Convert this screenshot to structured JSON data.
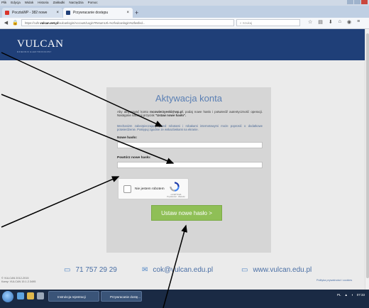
{
  "browser": {
    "menu": [
      "Plik",
      "Edycja",
      "Widok",
      "Historia",
      "Zakładki",
      "Narzędzia",
      "Pomoc"
    ],
    "tabs": [
      {
        "title": "PocztaWP - 382 nowe"
      },
      {
        "title": "Przywracanie dostępu"
      }
    ],
    "url_prefix": "https://cufs.",
    "url_domain": "vulcan.net.pl",
    "url_rest": "/vulcanlogin/Account/Login?ReturnUrl=%2fvulcanlogin%2fwsfed...",
    "search_placeholder": "Szukaj"
  },
  "header": {
    "logo": "VULCAN",
    "logo_sub": "DZIENNIK ELEKTRONICZNY"
  },
  "card": {
    "title": "Aktywacja konta",
    "intro_pre": "Aby aktywować konto ",
    "intro_email": "mcowierzyeski@wp.pl",
    "intro_post": ", podaj nowe hasło i potwierdź autentyczność operacji. Następnie naciśnij przycisk ",
    "intro_btn": "\"Ustaw nowe hasło\".",
    "note": "Mechanizm zabezpieczający przed robotami i robakami internetowymi może poprosić o dodatkowe potwierdzenie. Postępuj zgodnie ze wskazówkami na ekranie.",
    "new_password_label": "Nowe hasło:",
    "repeat_password_label": "Powtórz nowe hasło:",
    "captcha_label": "Nie jestem robotem",
    "captcha_brand": "reCAPTCHA",
    "captcha_terms": "Prywatność - Warunki",
    "submit_label": "Ustaw nowe hasło >"
  },
  "footer": {
    "phone": "71 757 29 29",
    "email": "cok@vulcan.edu.pl",
    "website": "www.vulcan.edu.pl",
    "copyright_line1": "© VULCAN 2012-2015",
    "copyright_line2": "Kamy: VULCAN 15.1.2.3495",
    "privacy": "Polityka prywatności i cookies"
  },
  "taskbar": {
    "task1": "Instrukcja rejestracji",
    "task2": "Przywracanie dostę...",
    "clock": "07:33"
  },
  "colors": {
    "header_bg": "#1f3f78",
    "title": "#5a7fb4",
    "submit_bg": "#8fbf56",
    "card_bg": "#d6d6d6"
  }
}
